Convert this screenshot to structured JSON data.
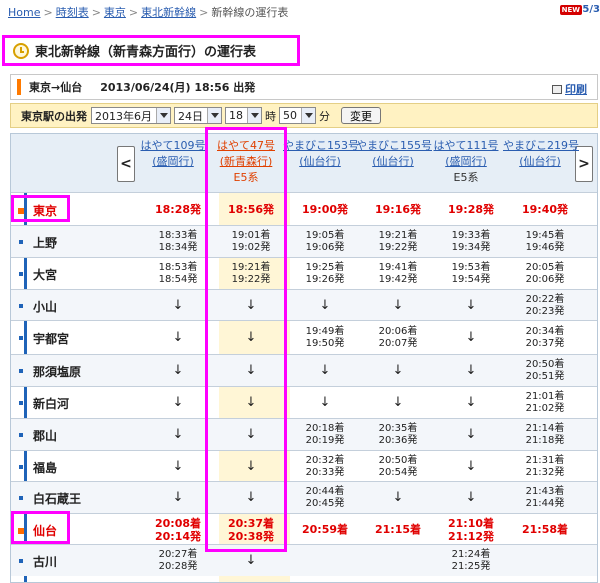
{
  "breadcrumb": [
    "Home",
    "時刻表",
    "東京",
    "東北新幹線",
    "新幹線の運行表"
  ],
  "badge_new": "NEW",
  "page_indicator": "5/3",
  "title": "東北新幹線（新青森方面行）の運行表",
  "route": {
    "from_to": "東京→仙台",
    "datetime": "2013/06/24(月) 18:56 出発",
    "print_label": "印刷"
  },
  "form": {
    "label": "東京駅の出発",
    "month": "2013年6月",
    "day": "24日",
    "hour": "18",
    "hour_unit": "時",
    "minute": "50",
    "minute_unit": "分",
    "button": "変更"
  },
  "nav": {
    "prev": "<",
    "next": ">"
  },
  "trains": [
    {
      "name": "はやて109号",
      "dest": "(盛岡行)",
      "type": ""
    },
    {
      "name": "はやて47号",
      "dest": "(新青森行)",
      "type": "E5系",
      "highlight": true
    },
    {
      "name": "やまびこ153号",
      "dest": "(仙台行)",
      "type": ""
    },
    {
      "name": "やまびこ155号",
      "dest": "(仙台行)",
      "type": ""
    },
    {
      "name": "はやて111号",
      "dest": "(盛岡行)",
      "type": "E5系"
    },
    {
      "name": "やまびこ219号",
      "dest": "(仙台行)",
      "type": ""
    }
  ],
  "stations": [
    {
      "name": "東京",
      "major": true,
      "cells": [
        [
          "18:28発"
        ],
        [
          "18:56発"
        ],
        [
          "19:00発"
        ],
        [
          "19:16発"
        ],
        [
          "19:28発"
        ],
        [
          "19:40発"
        ]
      ]
    },
    {
      "name": "上野",
      "cells": [
        [
          "18:33着",
          "18:34発"
        ],
        [
          "19:01着",
          "19:02発"
        ],
        [
          "19:05着",
          "19:06発"
        ],
        [
          "19:21着",
          "19:22発"
        ],
        [
          "19:33着",
          "19:34発"
        ],
        [
          "19:45着",
          "19:46発"
        ]
      ]
    },
    {
      "name": "大宮",
      "cells": [
        [
          "18:53着",
          "18:54発"
        ],
        [
          "19:21着",
          "19:22発"
        ],
        [
          "19:25着",
          "19:26発"
        ],
        [
          "19:41着",
          "19:42発"
        ],
        [
          "19:53着",
          "19:54発"
        ],
        [
          "20:05着",
          "20:06発"
        ]
      ]
    },
    {
      "name": "小山",
      "cells": [
        [
          "↓"
        ],
        [
          "↓"
        ],
        [
          "↓"
        ],
        [
          "↓"
        ],
        [
          "↓"
        ],
        [
          "20:22着",
          "20:23発"
        ]
      ]
    },
    {
      "name": "宇都宮",
      "cells": [
        [
          "↓"
        ],
        [
          "↓"
        ],
        [
          "19:49着",
          "19:50発"
        ],
        [
          "20:06着",
          "20:07発"
        ],
        [
          "↓"
        ],
        [
          "20:34着",
          "20:37発"
        ]
      ]
    },
    {
      "name": "那須塩原",
      "cells": [
        [
          "↓"
        ],
        [
          "↓"
        ],
        [
          "↓"
        ],
        [
          "↓"
        ],
        [
          "↓"
        ],
        [
          "20:50着",
          "20:51発"
        ]
      ]
    },
    {
      "name": "新白河",
      "cells": [
        [
          "↓"
        ],
        [
          "↓"
        ],
        [
          "↓"
        ],
        [
          "↓"
        ],
        [
          "↓"
        ],
        [
          "21:01着",
          "21:02発"
        ]
      ]
    },
    {
      "name": "郡山",
      "cells": [
        [
          "↓"
        ],
        [
          "↓"
        ],
        [
          "20:18着",
          "20:19発"
        ],
        [
          "20:35着",
          "20:36発"
        ],
        [
          "↓"
        ],
        [
          "21:14着",
          "21:18発"
        ]
      ]
    },
    {
      "name": "福島",
      "cells": [
        [
          "↓"
        ],
        [
          "↓"
        ],
        [
          "20:32着",
          "20:33発"
        ],
        [
          "20:50着",
          "20:54発"
        ],
        [
          "↓"
        ],
        [
          "21:31着",
          "21:32発"
        ]
      ]
    },
    {
      "name": "白石蔵王",
      "cells": [
        [
          "↓"
        ],
        [
          "↓"
        ],
        [
          "20:44着",
          "20:45発"
        ],
        [
          "↓"
        ],
        [
          "↓"
        ],
        [
          "21:43着",
          "21:44発"
        ]
      ]
    },
    {
      "name": "仙台",
      "major": true,
      "cells": [
        [
          "20:08着",
          "20:14発"
        ],
        [
          "20:37着",
          "20:38発"
        ],
        [
          "20:59着"
        ],
        [
          "21:15着"
        ],
        [
          "21:10着",
          "21:12発"
        ],
        [
          "21:58着"
        ]
      ]
    },
    {
      "name": "古川",
      "cells": [
        [
          "20:27着",
          "20:28発"
        ],
        [
          "↓"
        ],
        [
          ""
        ],
        [
          ""
        ],
        [
          "21:24着",
          "21:25発"
        ],
        [
          ""
        ]
      ]
    }
  ]
}
